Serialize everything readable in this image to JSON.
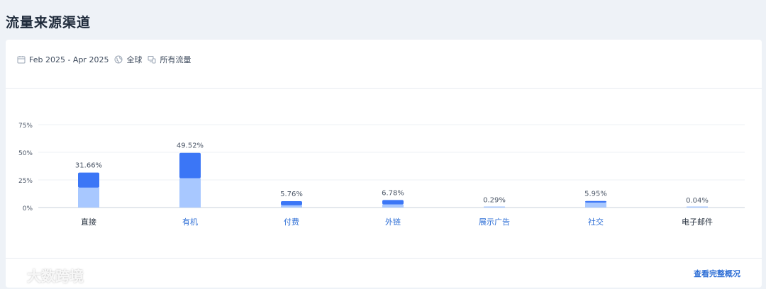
{
  "page": {
    "title": "流量来源渠道"
  },
  "filters": {
    "date_range": "Feb 2025 - Apr 2025",
    "region": "全球",
    "traffic": "所有流量"
  },
  "footer": {
    "view_full_label": "查看完整概况"
  },
  "watermark": {
    "text": "大数跨境"
  },
  "colors": {
    "bar_top": "#3b76f6",
    "bar_bottom": "#a8c8ff",
    "link": "#2f6fd6",
    "label_dark": "#2a3442"
  },
  "chart_data": {
    "type": "bar",
    "stacked": true,
    "categories": [
      "直接",
      "有机",
      "付费",
      "外链",
      "展示广告",
      "社交",
      "电子邮件"
    ],
    "category_clickable": [
      false,
      true,
      true,
      true,
      true,
      true,
      false
    ],
    "values": [
      31.66,
      49.52,
      5.76,
      6.78,
      0.29,
      5.95,
      0.04
    ],
    "value_labels": [
      "31.66%",
      "49.52%",
      "5.76%",
      "6.78%",
      "0.29%",
      "5.95%",
      "0.04%"
    ],
    "series": [
      {
        "values": [
          18.0,
          26.5,
          2.0,
          2.8,
          0.29,
          4.5,
          0.04
        ]
      },
      {
        "values": [
          13.66,
          23.02,
          3.76,
          3.98,
          0,
          1.45,
          0
        ]
      }
    ],
    "y_ticks": [
      "0%",
      "25%",
      "50%",
      "75%"
    ],
    "y_tick_values": [
      0,
      25,
      50,
      75
    ],
    "ylim": [
      0,
      75
    ],
    "grid": true
  }
}
